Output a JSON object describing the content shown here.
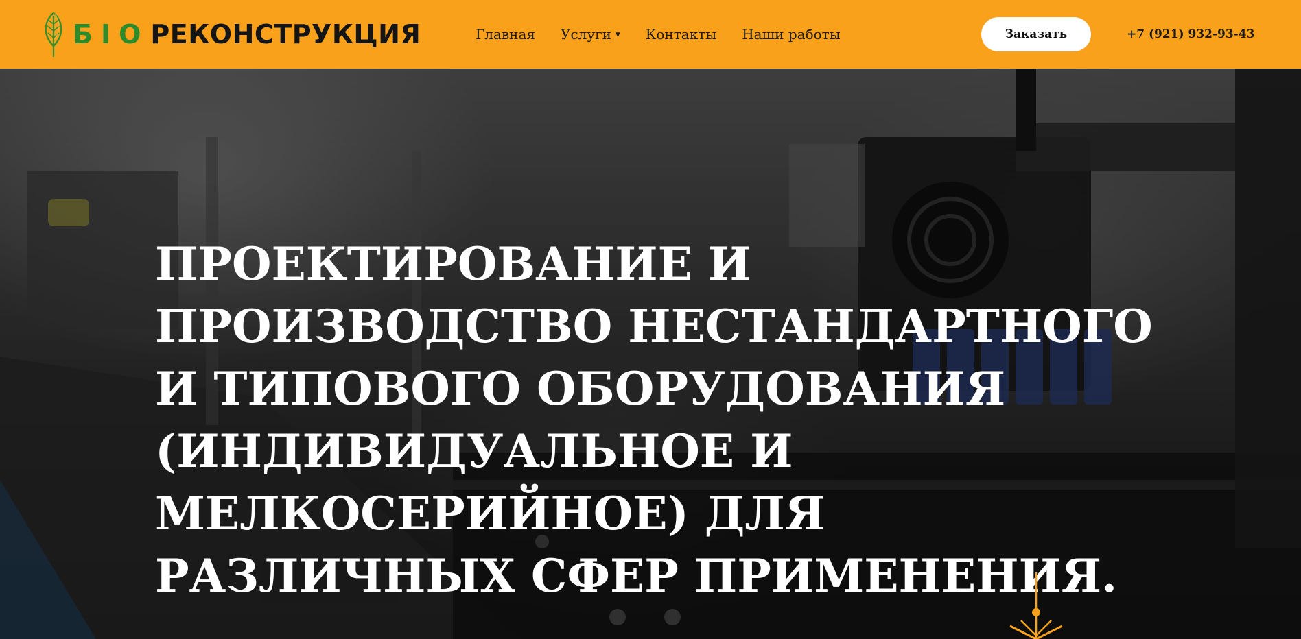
{
  "header": {
    "logo": {
      "bio_text": "БІО",
      "rest_text": "РЕКОНСТРУКЦИЯ",
      "icon": "leaf-icon",
      "bio_color": "#2e8a2a",
      "leaf_color": "#3a8f2c"
    },
    "nav": {
      "items": [
        {
          "label": "Главная"
        },
        {
          "label": "Услуги",
          "has_dropdown": true
        },
        {
          "label": "Контакты"
        },
        {
          "label": "Наши работы"
        }
      ],
      "dropdown_icon": "caret-down-icon"
    },
    "order_button_label": "Заказать",
    "phone": "+7 (921) 932-93-43"
  },
  "hero": {
    "title": "ПРОЕКТИРОВАНИЕ И ПРОИЗВОДСТВО НЕСТАНДАРТНОГО И ТИПОВОГО ОБОРУДОВАНИЯ (ИНДИВИДУАЛЬНОЕ И МЕЛКОСЕРИЙНОЕ) ДЛЯ РАЗЛИЧНЫХ СФЕР ПРИМЕНЕНИЯ.",
    "background": "3d-printer-photo",
    "scroll_icon": "scroll-down-arrow-icon"
  },
  "colors": {
    "header_bg": "#f9a11b",
    "accent": "#f9a11b",
    "button_bg": "#ffffff",
    "hero_text": "#ffffff"
  }
}
